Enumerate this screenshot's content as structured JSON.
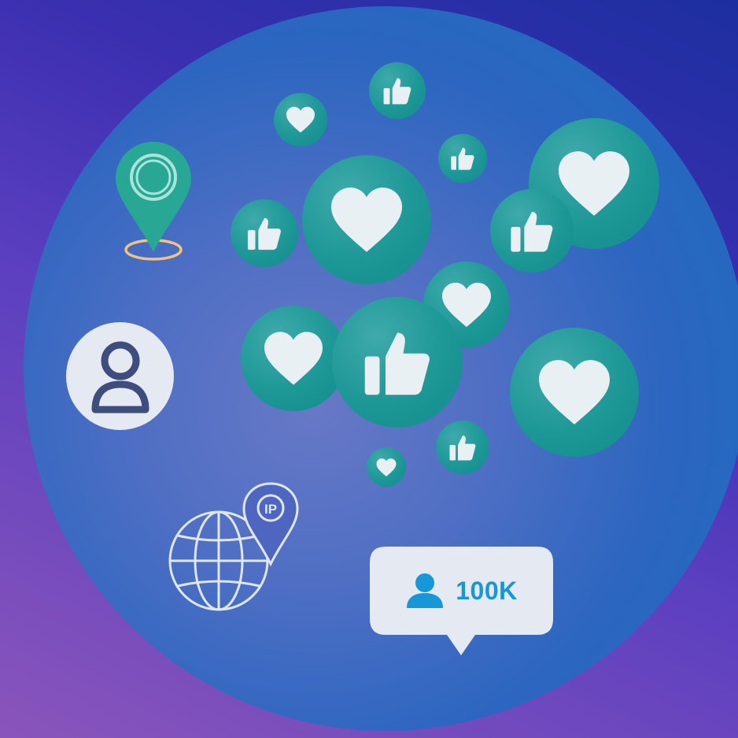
{
  "colors": {
    "background_start": "#1c2fa0",
    "background_end": "#8a55bb",
    "bubble": "#1c9896",
    "icon_fill": "#e8f0f4",
    "pin": "#27a794",
    "pin_ring": "#f5c27a",
    "follower_accent": "#1597d8",
    "card": "#e4e9f2"
  },
  "icons": [
    "heart-icon",
    "thumbs-up-icon",
    "location-pin-icon",
    "user-icon",
    "globe-icon",
    "ip-pin-icon"
  ],
  "follower_badge": {
    "count": "100K",
    "icon": "user-icon"
  },
  "globe_pin": {
    "label": "IP"
  }
}
